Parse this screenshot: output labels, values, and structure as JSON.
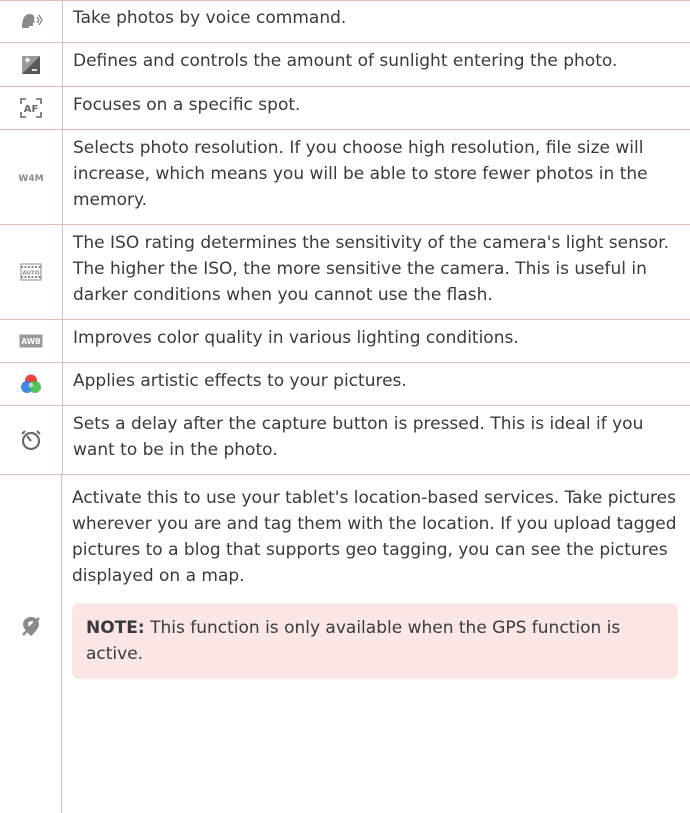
{
  "rows": [
    {
      "icon": "voice-shutter-icon",
      "text": "Take photos by voice command."
    },
    {
      "icon": "exposure-icon",
      "text": "Defines and controls the amount of sunlight entering the photo."
    },
    {
      "icon": "autofocus-icon",
      "icon_text": "AF",
      "text": "Focuses on a specific spot."
    },
    {
      "icon": "resolution-icon",
      "icon_text": "W4M",
      "text": "Selects photo resolution. If you choose high resolution, file size will increase, which means you will be able to store fewer photos in the memory."
    },
    {
      "icon": "iso-icon",
      "icon_text": "AUTO",
      "text": "The ISO rating determines the sensitivity of the camera's light sensor. The higher the ISO, the more sensitive the camera. This is useful in darker conditions when you cannot use the flash."
    },
    {
      "icon": "white-balance-icon",
      "icon_text": "AWB",
      "text": "Improves color quality in various lighting conditions."
    },
    {
      "icon": "color-effect-icon",
      "text": "Applies artistic effects to your pictures."
    },
    {
      "icon": "timer-icon",
      "text": "Sets a delay after the capture button is pressed. This is ideal if you want to be in the photo."
    },
    {
      "icon": "geotag-icon",
      "text": "Activate this to use your tablet's location-based services. Take pictures wherever you are and tag them with the location. If you upload tagged pictures to a blog that supports geo tagging, you can see the pictures displayed on a map."
    }
  ],
  "note": {
    "label": "NOTE:",
    "text": " This function is only available when the GPS function is active."
  },
  "colors": {
    "rule": "#e8b7b7",
    "note_bg": "#fbe6e6",
    "icon_gray": "#8a8a8a"
  }
}
